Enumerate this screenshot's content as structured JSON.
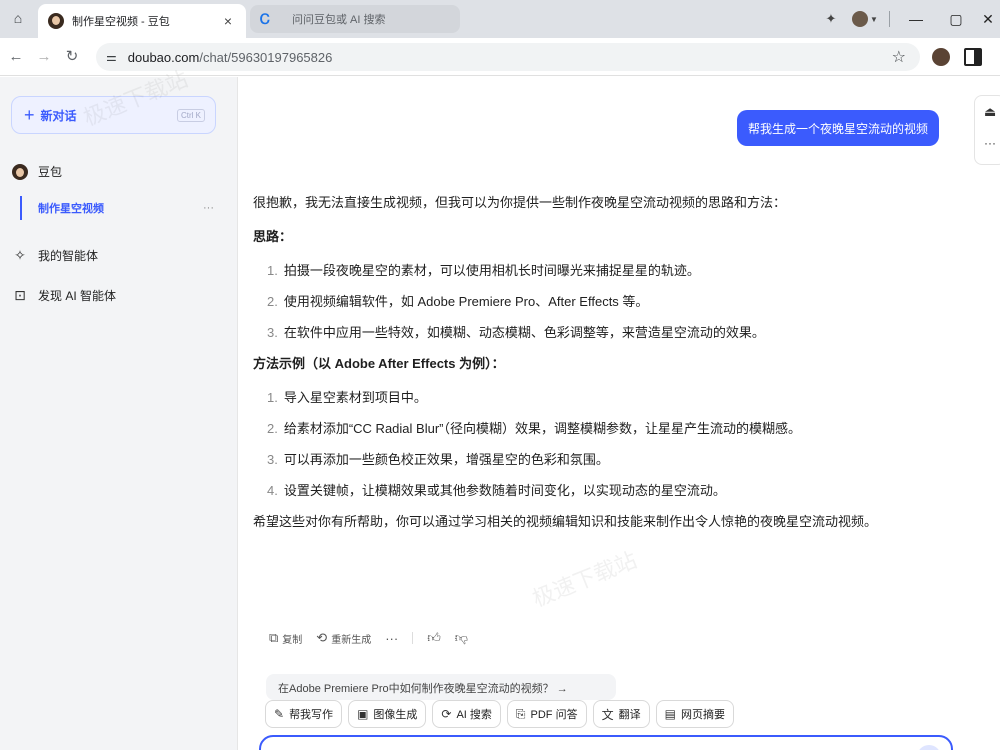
{
  "browser": {
    "active_tab_title": "制作星空视频 - 豆包",
    "inactive_tab_title": "问问豆包或 AI 搜索",
    "url_host": "doubao.com",
    "url_path": "/chat/59630197965826",
    "close_glyph": "×",
    "minimize_glyph": "—",
    "maximize_glyph": "▢",
    "window_close_glyph": "✕"
  },
  "sidebar": {
    "new_chat_label": "新对话",
    "new_chat_shortcut": "Ctrl K",
    "bot_name": "豆包",
    "active_conversation": "制作星空视频",
    "my_agents": "我的智能体",
    "discover_agents": "发现 AI 智能体"
  },
  "chat": {
    "user_message": "帮我生成一个夜晚星空流动的视频",
    "intro": "很抱歉，我无法直接生成视频，但我可以为你提供一些制作夜晚星空流动视频的思路和方法：",
    "heading_ideas": "思路：",
    "ideas": [
      {
        "num": "1.",
        "text": "拍摄一段夜晚星空的素材，可以使用相机长时间曝光来捕捉星星的轨迹。"
      },
      {
        "num": "2.",
        "text": "使用视频编辑软件，如 Adobe Premiere Pro、After Effects 等。"
      },
      {
        "num": "3.",
        "text": "在软件中应用一些特效，如模糊、动态模糊、色彩调整等，来营造星空流动的效果。"
      }
    ],
    "heading_method": "方法示例（以 Adobe After Effects 为例）：",
    "steps": [
      {
        "num": "1.",
        "text": "导入星空素材到项目中。"
      },
      {
        "num": "2.",
        "text": "给素材添加“CC Radial Blur”（径向模糊）效果，调整模糊参数，让星星产生流动的模糊感。"
      },
      {
        "num": "3.",
        "text": "可以再添加一些颜色校正效果，增强星空的色彩和氛围。"
      },
      {
        "num": "4.",
        "text": "设置关键帧，让模糊效果或其他参数随着时间变化，以实现动态的星空流动。"
      }
    ],
    "closing": "希望这些对你有所帮助，你可以通过学习相关的视频编辑知识和技能来制作出令人惊艳的夜晚星空流动视频。",
    "actions": {
      "copy": "复制",
      "regenerate": "重新生成"
    },
    "suggestion": "在Adobe Premiere Pro中如何制作夜晚星空流动的视频？ →"
  },
  "tools": [
    {
      "icon": "✎",
      "label": "帮我写作"
    },
    {
      "icon": "▣",
      "label": "图像生成"
    },
    {
      "icon": "⟳",
      "label": "AI 搜索"
    },
    {
      "icon": "⎘",
      "label": "PDF 问答"
    },
    {
      "icon": "文",
      "label": "翻译"
    },
    {
      "icon": "▤",
      "label": "网页摘要"
    }
  ],
  "watermarks": [
    "极速下载站",
    "极速下载站"
  ],
  "colors": {
    "accent": "#3b5bfd"
  }
}
